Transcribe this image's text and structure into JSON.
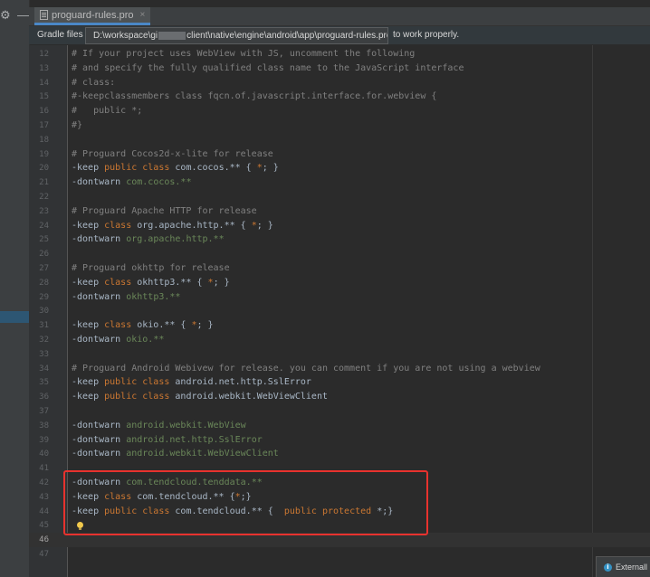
{
  "toolbar": {
    "gear_icon": "gear-icon",
    "minimize_icon": "minimize-icon"
  },
  "tab": {
    "label": "proguard-rules.pro",
    "close": "×"
  },
  "banner": {
    "message_start": "Gradle files h",
    "message_end": "to work properly."
  },
  "tooltip": {
    "path_before": "D:\\workspace\\gi",
    "path_after": "client\\native\\engine\\android\\app\\proguard-rules.pro"
  },
  "editor": {
    "current_line": 46,
    "lines": [
      {
        "n": "12",
        "tokens": [
          {
            "c": "cm",
            "t": "# If your project uses WebView with JS, uncomment the following"
          }
        ]
      },
      {
        "n": "13",
        "tokens": [
          {
            "c": "cm",
            "t": "# and specify the fully qualified class name to the JavaScript interface"
          }
        ]
      },
      {
        "n": "14",
        "tokens": [
          {
            "c": "cm",
            "t": "# class:"
          }
        ]
      },
      {
        "n": "15",
        "tokens": [
          {
            "c": "cm",
            "t": "#-keepclassmembers class fqcn.of.javascript.interface.for.webview {"
          }
        ]
      },
      {
        "n": "16",
        "tokens": [
          {
            "c": "cm",
            "t": "#   public *;"
          }
        ]
      },
      {
        "n": "17",
        "tokens": [
          {
            "c": "cm",
            "t": "#}"
          }
        ]
      },
      {
        "n": "18",
        "tokens": []
      },
      {
        "n": "19",
        "tokens": [
          {
            "c": "cm",
            "t": "# Proguard Cocos2d-x-lite for release"
          }
        ]
      },
      {
        "n": "20",
        "tokens": [
          {
            "c": "pl",
            "t": "-keep "
          },
          {
            "c": "kw",
            "t": "public class "
          },
          {
            "c": "pl",
            "t": "com.cocos.** { "
          },
          {
            "c": "kw",
            "t": "*"
          },
          {
            "c": "pl",
            "t": "; }"
          }
        ]
      },
      {
        "n": "21",
        "tokens": [
          {
            "c": "pl",
            "t": "-dontwarn "
          },
          {
            "c": "gr",
            "t": "com.cocos.**"
          }
        ]
      },
      {
        "n": "22",
        "tokens": []
      },
      {
        "n": "23",
        "tokens": [
          {
            "c": "cm",
            "t": "# Proguard Apache HTTP for release"
          }
        ]
      },
      {
        "n": "24",
        "tokens": [
          {
            "c": "pl",
            "t": "-keep "
          },
          {
            "c": "kw",
            "t": "class "
          },
          {
            "c": "pl",
            "t": "org.apache.http.** { "
          },
          {
            "c": "kw",
            "t": "*"
          },
          {
            "c": "pl",
            "t": "; }"
          }
        ]
      },
      {
        "n": "25",
        "tokens": [
          {
            "c": "pl",
            "t": "-dontwarn "
          },
          {
            "c": "gr",
            "t": "org.apache.http.**"
          }
        ]
      },
      {
        "n": "26",
        "tokens": []
      },
      {
        "n": "27",
        "tokens": [
          {
            "c": "cm",
            "t": "# Proguard okhttp for release"
          }
        ]
      },
      {
        "n": "28",
        "tokens": [
          {
            "c": "pl",
            "t": "-keep "
          },
          {
            "c": "kw",
            "t": "class "
          },
          {
            "c": "pl",
            "t": "okhttp3.** { "
          },
          {
            "c": "kw",
            "t": "*"
          },
          {
            "c": "pl",
            "t": "; }"
          }
        ]
      },
      {
        "n": "29",
        "tokens": [
          {
            "c": "pl",
            "t": "-dontwarn "
          },
          {
            "c": "gr",
            "t": "okhttp3.**"
          }
        ]
      },
      {
        "n": "30",
        "tokens": []
      },
      {
        "n": "31",
        "tokens": [
          {
            "c": "pl",
            "t": "-keep "
          },
          {
            "c": "kw",
            "t": "class "
          },
          {
            "c": "pl",
            "t": "okio.** { "
          },
          {
            "c": "kw",
            "t": "*"
          },
          {
            "c": "pl",
            "t": "; }"
          }
        ]
      },
      {
        "n": "32",
        "tokens": [
          {
            "c": "pl",
            "t": "-dontwarn "
          },
          {
            "c": "gr",
            "t": "okio.**"
          }
        ]
      },
      {
        "n": "33",
        "tokens": []
      },
      {
        "n": "34",
        "tokens": [
          {
            "c": "cm",
            "t": "# Proguard Android Webivew for release. you can comment if you are not using a webview"
          }
        ]
      },
      {
        "n": "35",
        "tokens": [
          {
            "c": "pl",
            "t": "-keep "
          },
          {
            "c": "kw",
            "t": "public class "
          },
          {
            "c": "pl",
            "t": "android.net.http.SslError"
          }
        ]
      },
      {
        "n": "36",
        "tokens": [
          {
            "c": "pl",
            "t": "-keep "
          },
          {
            "c": "kw",
            "t": "public class "
          },
          {
            "c": "pl",
            "t": "android.webkit.WebViewClient"
          }
        ]
      },
      {
        "n": "37",
        "tokens": []
      },
      {
        "n": "38",
        "tokens": [
          {
            "c": "pl",
            "t": "-dontwarn "
          },
          {
            "c": "gr",
            "t": "android.webkit.WebView"
          }
        ]
      },
      {
        "n": "39",
        "tokens": [
          {
            "c": "pl",
            "t": "-dontwarn "
          },
          {
            "c": "gr",
            "t": "android.net.http.SslError"
          }
        ]
      },
      {
        "n": "40",
        "tokens": [
          {
            "c": "pl",
            "t": "-dontwarn "
          },
          {
            "c": "gr",
            "t": "android.webkit.WebViewClient"
          }
        ]
      },
      {
        "n": "41",
        "tokens": []
      },
      {
        "n": "42",
        "tokens": [
          {
            "c": "pl",
            "t": "-dontwarn "
          },
          {
            "c": "gr",
            "t": "com.tendcloud.tenddata.**"
          }
        ]
      },
      {
        "n": "43",
        "tokens": [
          {
            "c": "pl",
            "t": "-keep "
          },
          {
            "c": "kw",
            "t": "class "
          },
          {
            "c": "pl",
            "t": "com.tendcloud.** {"
          },
          {
            "c": "kw",
            "t": "*"
          },
          {
            "c": "pl",
            "t": ";}"
          }
        ]
      },
      {
        "n": "44",
        "tokens": [
          {
            "c": "pl",
            "t": "-keep "
          },
          {
            "c": "kw",
            "t": "public class "
          },
          {
            "c": "pl",
            "t": "com.tendcloud.** {  "
          },
          {
            "c": "kw",
            "t": "public protected "
          },
          {
            "c": "pl",
            "t": "*;}"
          }
        ]
      },
      {
        "n": "45",
        "tokens": []
      },
      {
        "n": "46",
        "tokens": []
      },
      {
        "n": "47",
        "tokens": []
      }
    ]
  },
  "notification": {
    "label": "Externall"
  },
  "colors": {
    "comment": "#808080",
    "keyword": "#cc7832",
    "plain": "#a9b7c6",
    "package_string": "#6a8759",
    "highlight_box": "#e8322e",
    "tab_underline": "#4a88c7"
  }
}
